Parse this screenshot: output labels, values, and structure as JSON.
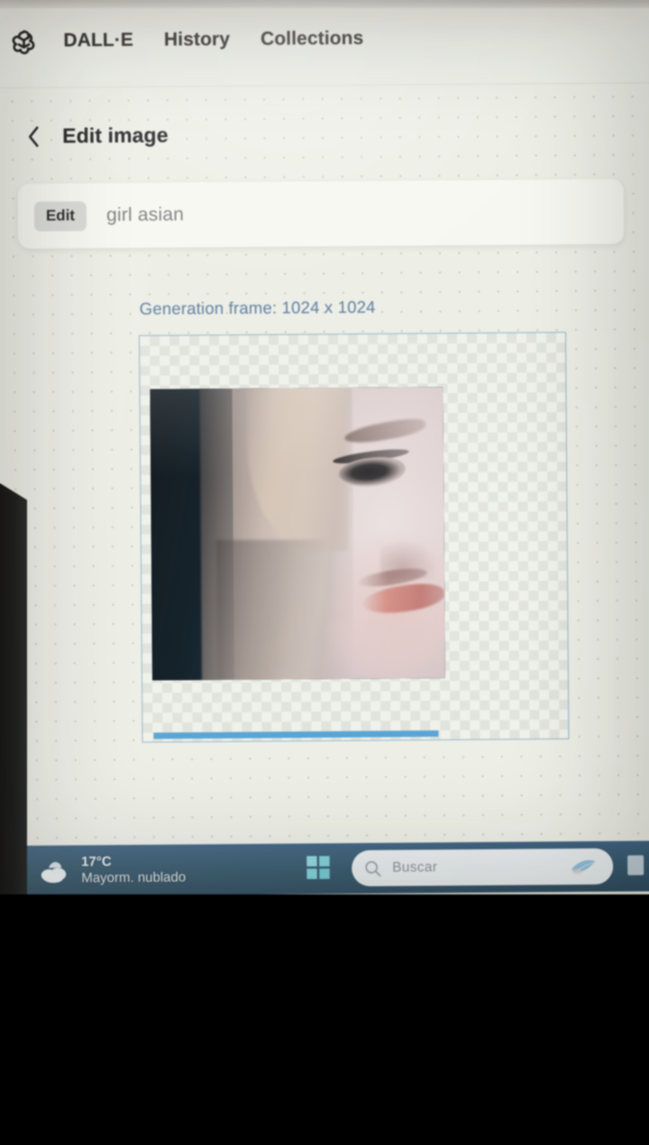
{
  "app": {
    "logo_icon": "openai-logo-icon",
    "nav": [
      {
        "label": "DALL·E",
        "name": "dalle"
      },
      {
        "label": "History",
        "name": "history"
      },
      {
        "label": "Collections",
        "name": "collections"
      }
    ]
  },
  "page": {
    "back_icon": "chevron-left-icon",
    "title": "Edit image"
  },
  "prompt_bar": {
    "chip_label": "Edit",
    "prompt_text": "girl asian"
  },
  "generation": {
    "frame_label": "Generation frame: 1024 x 1024",
    "frame_width": "1024",
    "frame_height": "1024",
    "progress_percent": 70,
    "progress_color": "#4f9fd2",
    "frame_border_color": "#8fb0c6",
    "label_color": "#5f7ea0",
    "image_alt": "portrait of an asian girl with light blonde hair, partial face, dark background on the left"
  },
  "taskbar": {
    "weather_icon": "cloud-icon",
    "temperature": "17°C",
    "condition": "Mayorm. nublado",
    "start_icon": "windows-start-icon",
    "search_icon": "search-icon",
    "search_placeholder": "Buscar",
    "copilot_icon": "copilot-bird-icon",
    "tray_icon": "tray-icon",
    "background_color": "#35596f"
  }
}
